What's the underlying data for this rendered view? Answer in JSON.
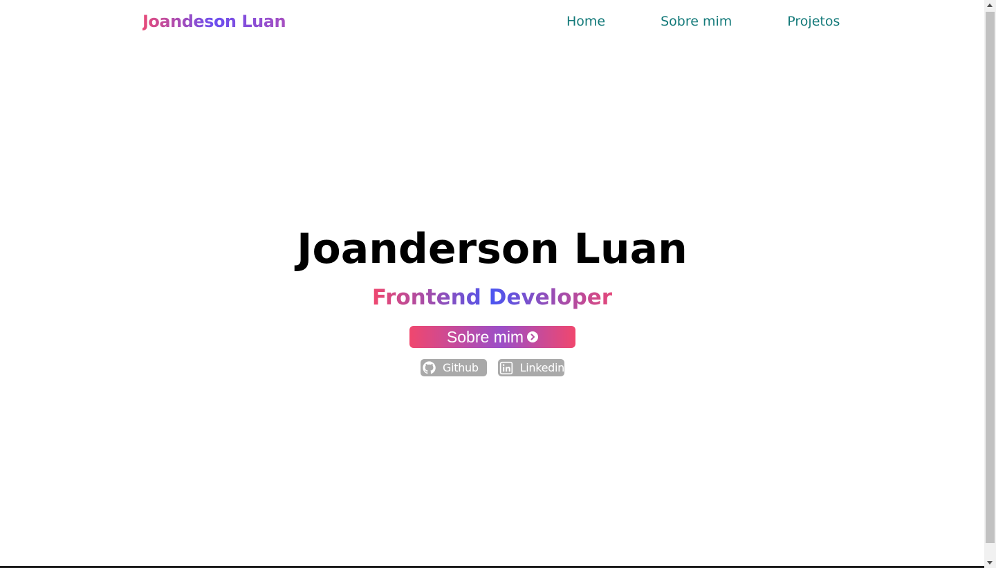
{
  "header": {
    "logo": "Joandeson Luan",
    "nav": [
      {
        "label": "Home"
      },
      {
        "label": "Sobre mim"
      },
      {
        "label": "Projetos"
      }
    ]
  },
  "hero": {
    "title": "Joanderson Luan",
    "subtitle": "Frontend Developer",
    "cta_label": "Sobre mim",
    "cta_icon": "chevron-circle-right-icon",
    "social": [
      {
        "label": "Github",
        "icon": "github-icon"
      },
      {
        "label": "Linkedin",
        "icon": "linkedin-icon"
      }
    ]
  },
  "colors": {
    "nav_text": "#147a7a",
    "title": "#000000",
    "gradient_pink": "#f0476e",
    "gradient_blue": "#4c55f0",
    "gradient_purple": "#9b4fc8",
    "social_bg": "#a9a9a9"
  }
}
